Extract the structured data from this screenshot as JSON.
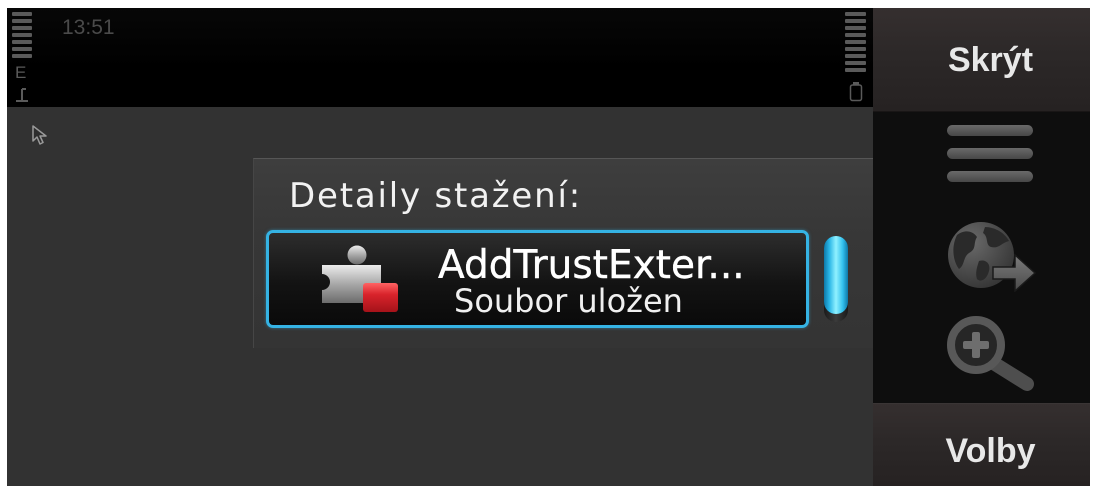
{
  "status_bar": {
    "time": "13:51",
    "network_mode": "E",
    "signal_icon": "signal-strength-icon",
    "battery_icon": "battery-icon"
  },
  "pointer_icon": "cursor-icon",
  "dialog": {
    "title": "Detaily stažení:",
    "items": [
      {
        "icon": "plugin-icon",
        "name": "AddTrustExter...",
        "status": "Soubor uložen",
        "selected": true
      }
    ]
  },
  "softkeys": {
    "top": "Skrýt",
    "bottom": "Volby"
  },
  "toolbar": {
    "items": [
      {
        "icon": "menu-icon"
      },
      {
        "icon": "globe-arrow-icon"
      },
      {
        "icon": "zoom-in-icon"
      }
    ]
  },
  "colors": {
    "highlight": "#35b3e4",
    "screen_background": "#323232",
    "status_bar": "#000000",
    "softkey_background": "#2c2828",
    "toolbar_background": "#0e0e0e"
  }
}
